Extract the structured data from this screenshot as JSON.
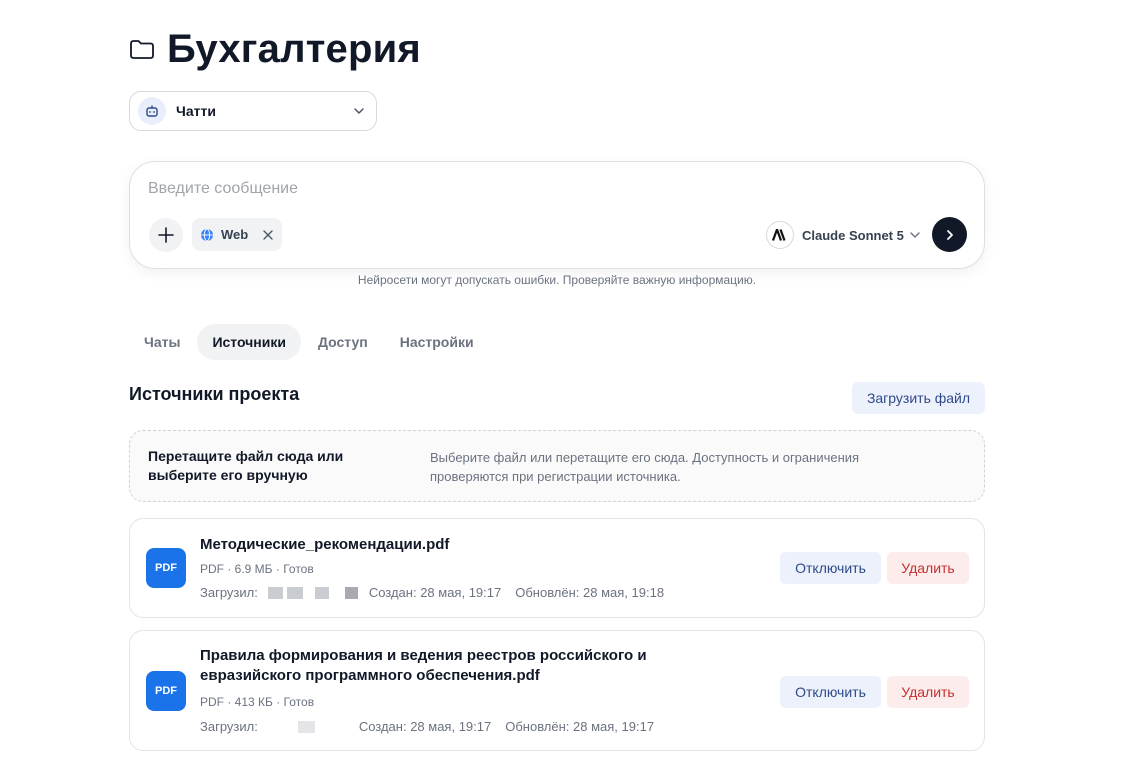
{
  "header": {
    "title": "Бухгалтерия",
    "icon": "folder-icon"
  },
  "agent": {
    "name": "Чатти",
    "icon": "robot-icon"
  },
  "composer": {
    "placeholder": "Введите сообщение",
    "value": "",
    "web_chip": "Web",
    "model": "Claude Sonnet 5"
  },
  "disclaimer": "Нейросети могут допускать ошибки. Проверяйте важную информацию.",
  "tabs": [
    {
      "label": "Чаты",
      "active": false
    },
    {
      "label": "Источники",
      "active": true
    },
    {
      "label": "Доступ",
      "active": false
    },
    {
      "label": "Настройки",
      "active": false
    }
  ],
  "sources": {
    "title": "Источники проекта",
    "upload_label": "Загрузить файл",
    "dropzone": {
      "title": "Перетащите файл сюда или выберите его вручную",
      "description": "Выберите файл или перетащите его сюда. Доступность и ограничения проверяются при регистрации источника."
    },
    "files": [
      {
        "badge": "PDF",
        "name": "Методические_рекомендации.pdf",
        "meta": "PDF · 6.9 МБ · Готов",
        "uploaded_label": "Загрузил:",
        "created": "Создан: 28 мая, 19:17",
        "updated": "Обновлён: 28 мая, 19:18",
        "disable_label": "Отключить",
        "delete_label": "Удалить"
      },
      {
        "badge": "PDF",
        "name": "Правила формирования и ведения реестров российского и евразийского программного обеспечения.pdf",
        "meta": "PDF · 413 КБ · Готов",
        "uploaded_label": "Загрузил:",
        "created": "Создан: 28 мая, 19:17",
        "updated": "Обновлён: 28 мая, 19:17",
        "disable_label": "Отключить",
        "delete_label": "Удалить"
      }
    ]
  },
  "colors": {
    "accent": "#1a73e8",
    "text": "#111827",
    "muted": "#6b7280",
    "danger": "#c53030",
    "primary_soft": "#edf1fb"
  }
}
